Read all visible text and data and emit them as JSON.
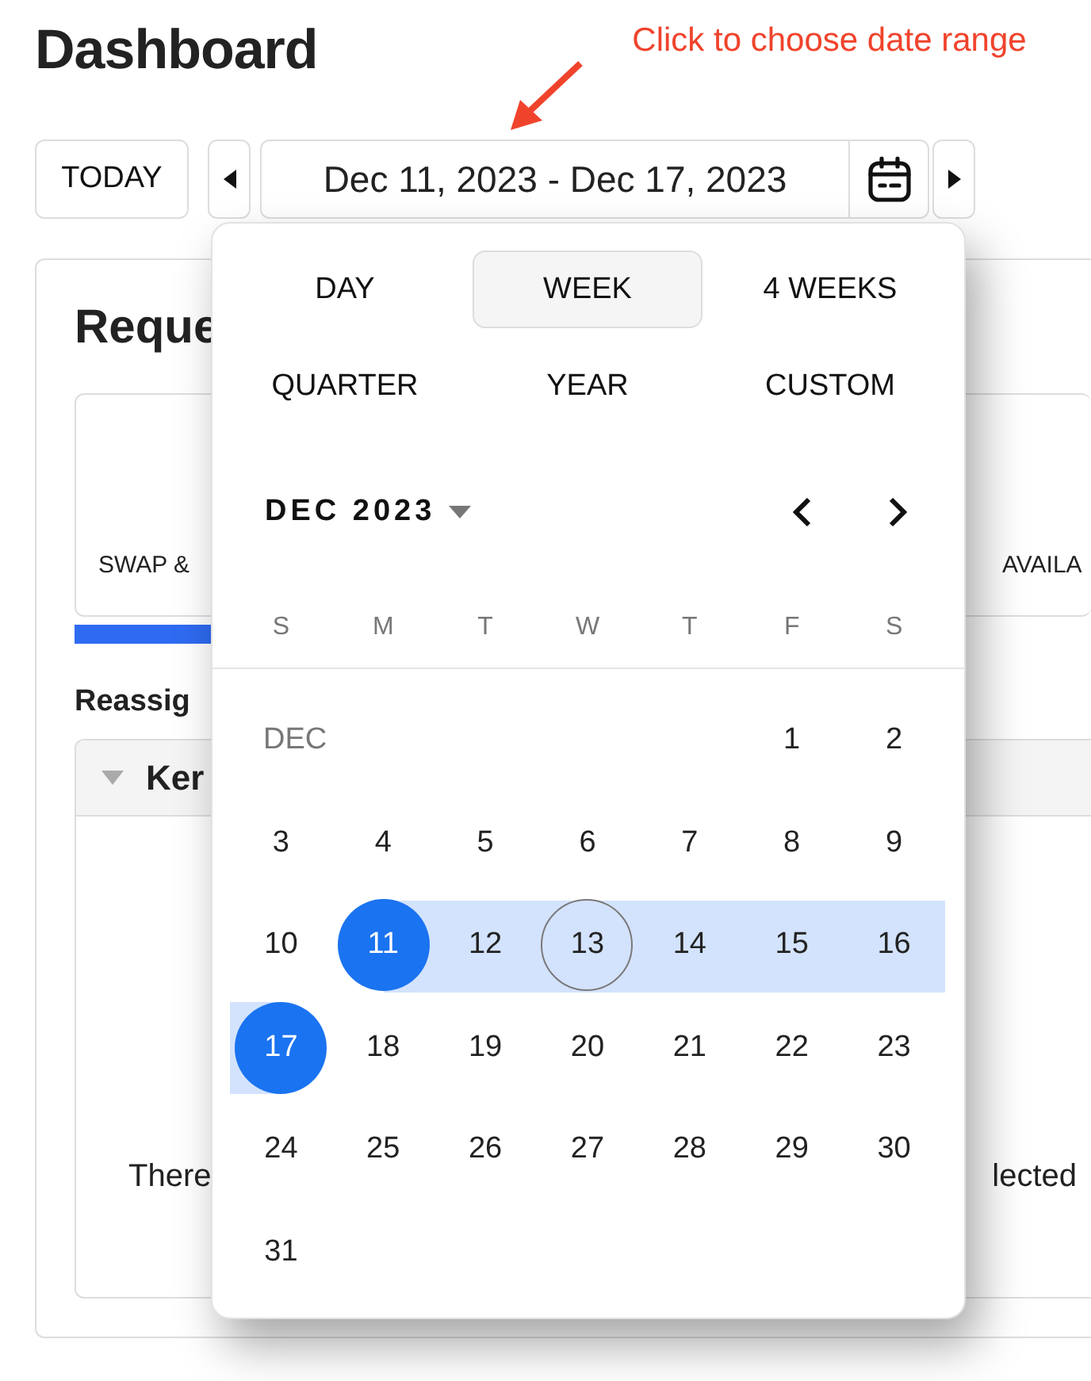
{
  "page": {
    "title": "Dashboard"
  },
  "annotation": {
    "text": "Click to choose date range"
  },
  "toolbar": {
    "today": "TODAY",
    "range": "Dec 11, 2023 - Dec 17, 2023"
  },
  "card": {
    "title": "Reque",
    "tiles": [
      {
        "label": "SWAP &",
        "selected": true
      },
      {
        "label": "AVAILA",
        "selected": false
      }
    ],
    "section_label": "Reassig",
    "panel": {
      "title": "Ker",
      "expanded": true,
      "message_start": "There",
      "message_end": "lected"
    }
  },
  "picker": {
    "periods": [
      {
        "label": "DAY",
        "selected": false
      },
      {
        "label": "WEEK",
        "selected": true
      },
      {
        "label": "4 WEEKS",
        "selected": false
      },
      {
        "label": "QUARTER",
        "selected": false
      },
      {
        "label": "YEAR",
        "selected": false
      },
      {
        "label": "CUSTOM",
        "selected": false
      }
    ],
    "month": "DEC 2023",
    "weekdays": [
      "S",
      "M",
      "T",
      "W",
      "T",
      "F",
      "S"
    ],
    "weeks": [
      {
        "label": "DEC",
        "days": [
          {
            "day": "1",
            "in_range": false,
            "range_start": false,
            "range_end": false,
            "today": false
          },
          {
            "day": "2",
            "in_range": false,
            "range_start": false,
            "range_end": false,
            "today": false
          }
        ]
      },
      {
        "days": [
          {
            "day": "3",
            "in_range": false,
            "range_start": false,
            "range_end": false,
            "today": false
          },
          {
            "day": "4",
            "in_range": false,
            "range_start": false,
            "range_end": false,
            "today": false
          },
          {
            "day": "5",
            "in_range": false,
            "range_start": false,
            "range_end": false,
            "today": false
          },
          {
            "day": "6",
            "in_range": false,
            "range_start": false,
            "range_end": false,
            "today": false
          },
          {
            "day": "7",
            "in_range": false,
            "range_start": false,
            "range_end": false,
            "today": false
          },
          {
            "day": "8",
            "in_range": false,
            "range_start": false,
            "range_end": false,
            "today": false
          },
          {
            "day": "9",
            "in_range": false,
            "range_start": false,
            "range_end": false,
            "today": false
          }
        ]
      },
      {
        "days": [
          {
            "day": "10",
            "in_range": false,
            "range_start": false,
            "range_end": false,
            "today": false
          },
          {
            "day": "11",
            "in_range": true,
            "range_start": true,
            "range_end": false,
            "today": false
          },
          {
            "day": "12",
            "in_range": true,
            "range_start": false,
            "range_end": false,
            "today": false
          },
          {
            "day": "13",
            "in_range": true,
            "range_start": false,
            "range_end": false,
            "today": true
          },
          {
            "day": "14",
            "in_range": true,
            "range_start": false,
            "range_end": false,
            "today": false
          },
          {
            "day": "15",
            "in_range": true,
            "range_start": false,
            "range_end": false,
            "today": false
          },
          {
            "day": "16",
            "in_range": true,
            "range_start": false,
            "range_end": false,
            "today": false
          }
        ]
      },
      {
        "days": [
          {
            "day": "17",
            "in_range": true,
            "range_start": false,
            "range_end": true,
            "today": false
          },
          {
            "day": "18",
            "in_range": false,
            "range_start": false,
            "range_end": false,
            "today": false
          },
          {
            "day": "19",
            "in_range": false,
            "range_start": false,
            "range_end": false,
            "today": false
          },
          {
            "day": "20",
            "in_range": false,
            "range_start": false,
            "range_end": false,
            "today": false
          },
          {
            "day": "21",
            "in_range": false,
            "range_start": false,
            "range_end": false,
            "today": false
          },
          {
            "day": "22",
            "in_range": false,
            "range_start": false,
            "range_end": false,
            "today": false
          },
          {
            "day": "23",
            "in_range": false,
            "range_start": false,
            "range_end": false,
            "today": false
          }
        ]
      },
      {
        "days": [
          {
            "day": "24",
            "in_range": false,
            "range_start": false,
            "range_end": false,
            "today": false
          },
          {
            "day": "25",
            "in_range": false,
            "range_start": false,
            "range_end": false,
            "today": false
          },
          {
            "day": "26",
            "in_range": false,
            "range_start": false,
            "range_end": false,
            "today": false
          },
          {
            "day": "27",
            "in_range": false,
            "range_start": false,
            "range_end": false,
            "today": false
          },
          {
            "day": "28",
            "in_range": false,
            "range_start": false,
            "range_end": false,
            "today": false
          },
          {
            "day": "29",
            "in_range": false,
            "range_start": false,
            "range_end": false,
            "today": false
          },
          {
            "day": "30",
            "in_range": false,
            "range_start": false,
            "range_end": false,
            "today": false
          }
        ]
      },
      {
        "days": [
          {
            "day": "31",
            "in_range": false,
            "range_start": false,
            "range_end": false,
            "today": false
          }
        ]
      }
    ]
  }
}
